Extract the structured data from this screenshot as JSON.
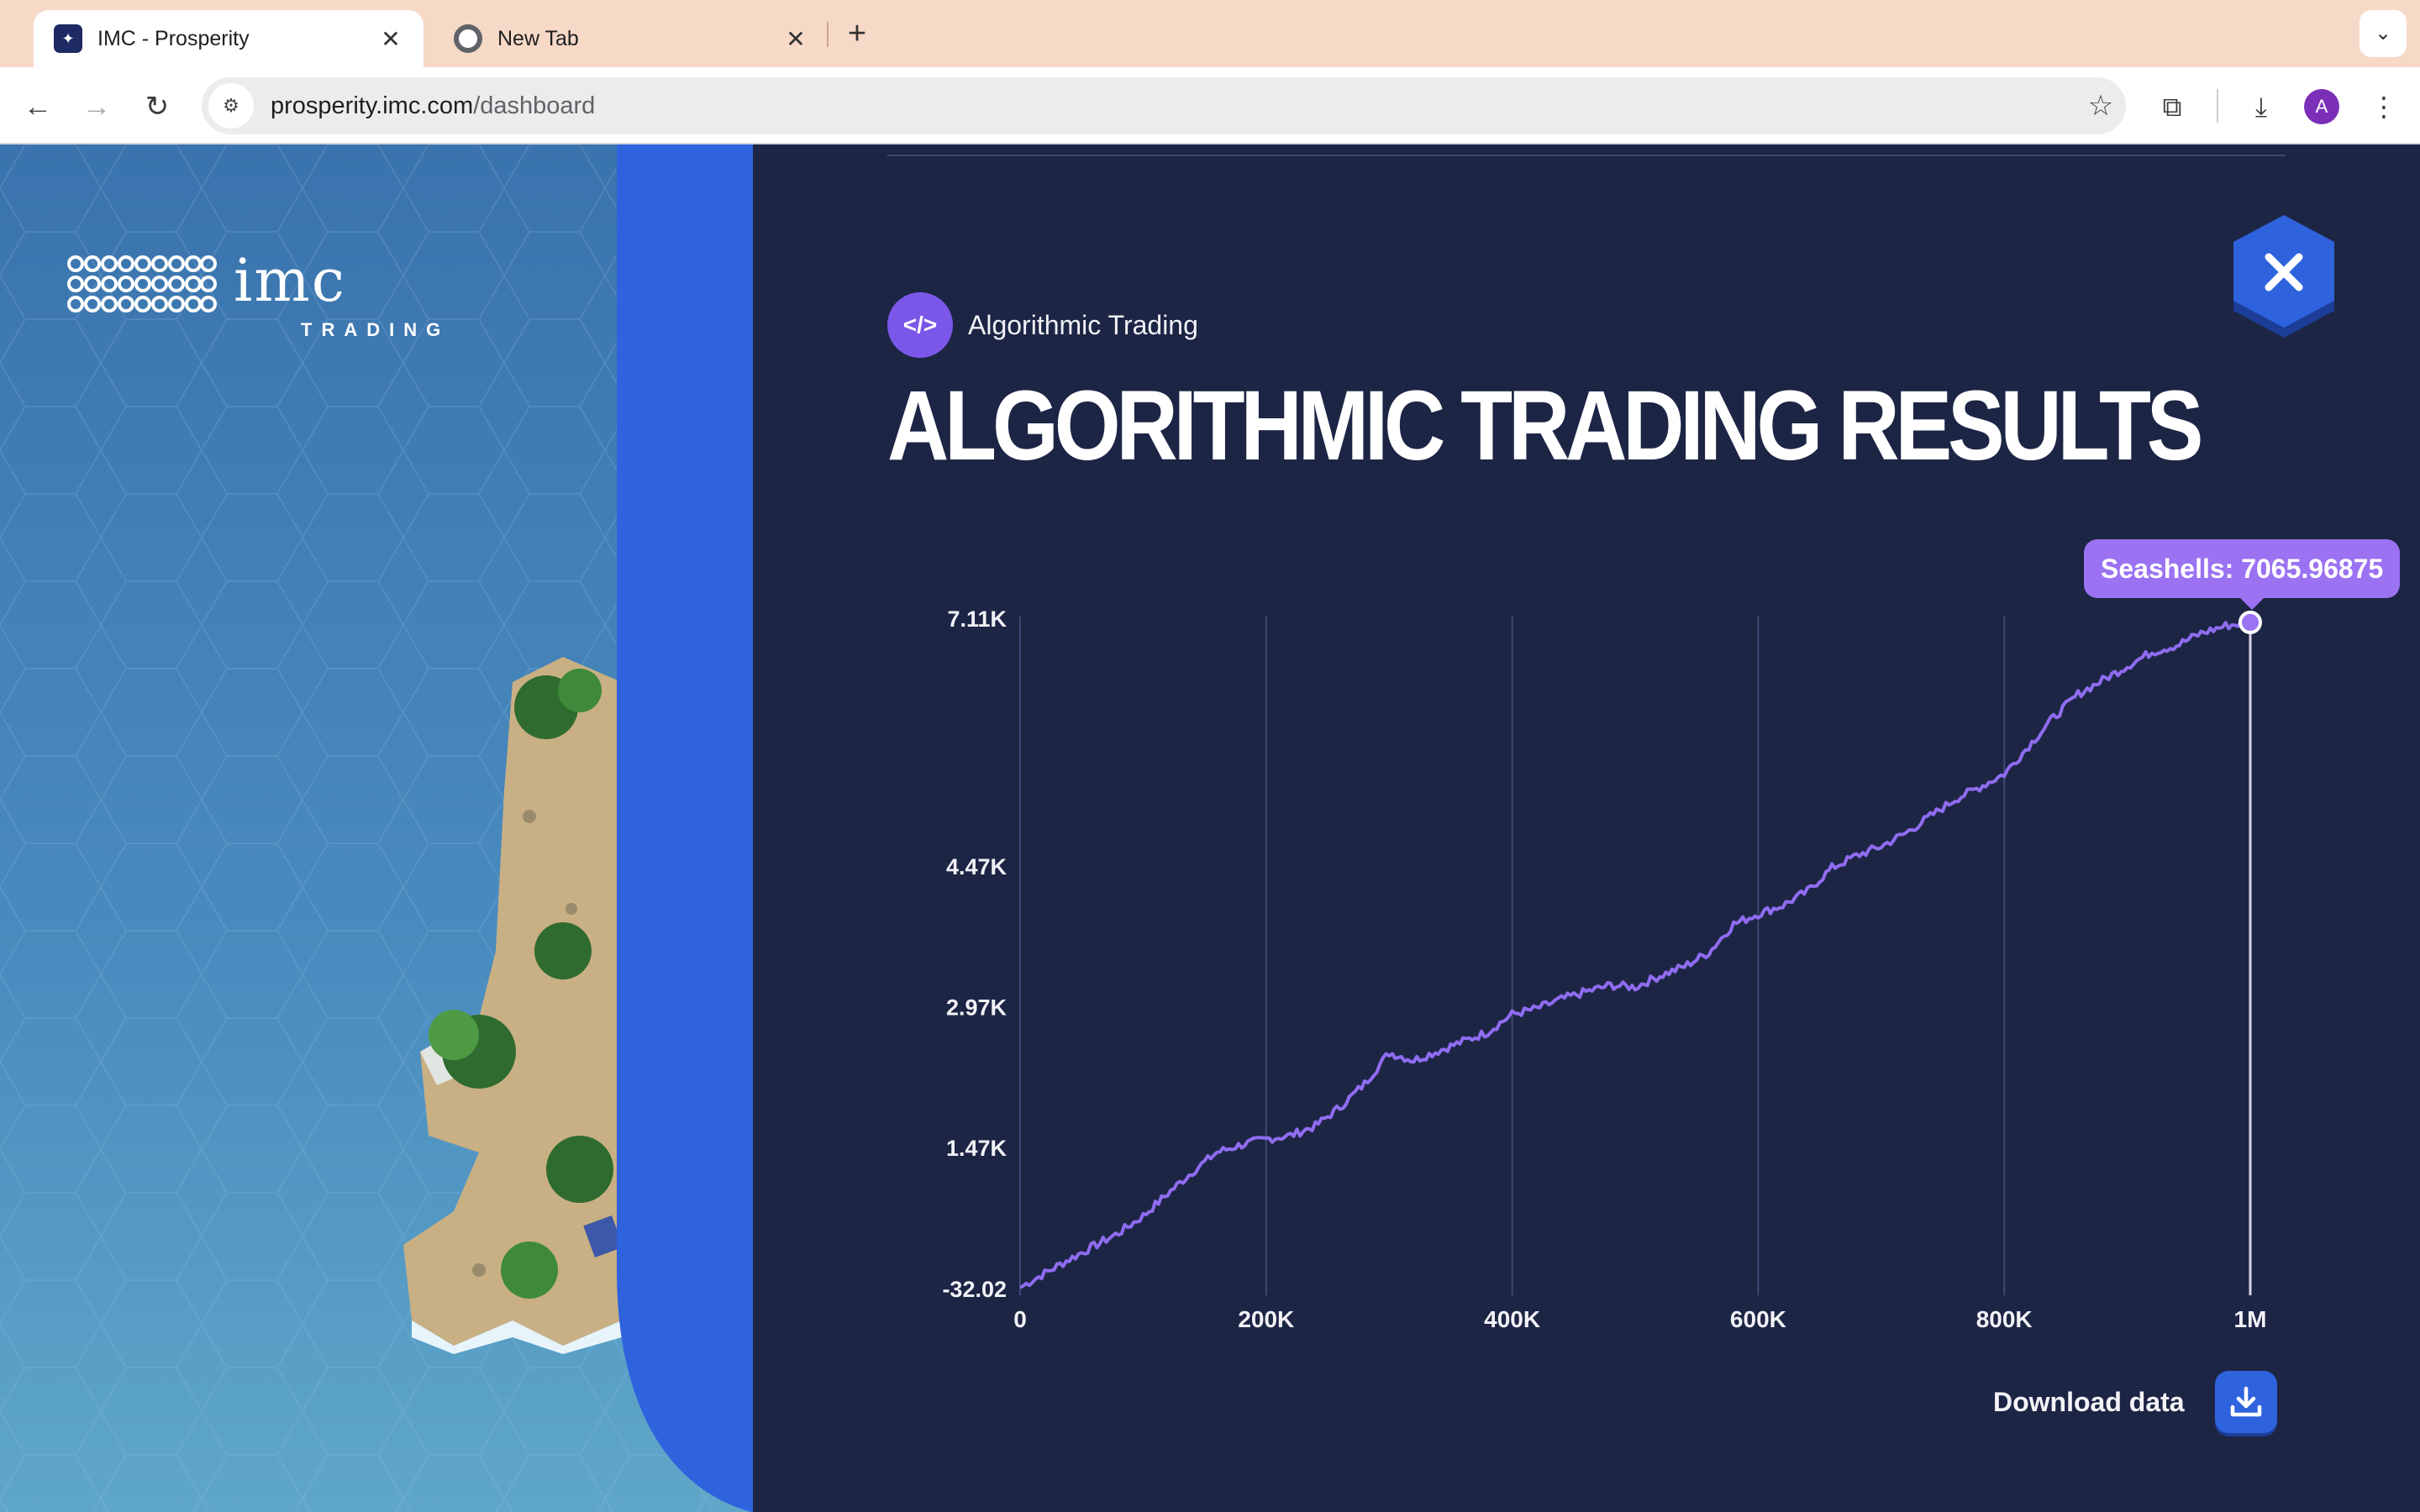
{
  "browser": {
    "tabs": [
      {
        "title": "IMC - Prosperity",
        "active": true
      },
      {
        "title": "New Tab",
        "active": false
      }
    ],
    "url_host": "prosperity.imc.com",
    "url_path": "/dashboard",
    "avatar_letter": "A"
  },
  "brand": {
    "logo_word": "imc",
    "logo_sub": "TRADING"
  },
  "header": {
    "category": "Algorithmic Trading",
    "title": "ALGORITHMIC TRADING RESULTS"
  },
  "tooltip": {
    "text": "Seashells: 7065.96875"
  },
  "actions": {
    "download_label": "Download data"
  },
  "colors": {
    "page_bg": "#1d2545",
    "accent_blue": "#2f63de",
    "line_purple": "#8f6cf0",
    "tooltip_bg": "#9a72f2"
  },
  "chart_data": {
    "type": "line",
    "title": "",
    "xlabel": "",
    "ylabel": "",
    "x_ticks": [
      "0",
      "200K",
      "400K",
      "600K",
      "800K",
      "1M"
    ],
    "y_ticks": [
      "-32.02",
      "1.47K",
      "2.97K",
      "4.47K",
      "7.11K"
    ],
    "y_tick_values": [
      -32.02,
      1470,
      2970,
      4470,
      7110
    ],
    "xlim": [
      0,
      1000000
    ],
    "ylim": [
      -32.02,
      7110
    ],
    "grid": "vertical",
    "series": [
      {
        "x": [
          0,
          20000,
          40000,
          60000,
          80000,
          100000,
          120000,
          140000,
          160000,
          180000,
          200000,
          220000,
          240000,
          260000,
          280000,
          300000,
          320000,
          340000,
          360000,
          380000,
          400000,
          420000,
          440000,
          460000,
          480000,
          500000,
          520000,
          540000,
          560000,
          580000,
          600000,
          620000,
          640000,
          660000,
          680000,
          700000,
          720000,
          740000,
          760000,
          780000,
          800000,
          820000,
          840000,
          860000,
          880000,
          900000,
          920000,
          940000,
          960000,
          980000,
          1000000
        ],
        "values": [
          -20,
          130,
          280,
          420,
          560,
          740,
          980,
          1210,
          1420,
          1500,
          1560,
          1600,
          1700,
          1900,
          2150,
          2480,
          2400,
          2500,
          2600,
          2700,
          2890,
          2950,
          3050,
          3130,
          3200,
          3180,
          3300,
          3400,
          3550,
          3850,
          3960,
          4050,
          4200,
          4450,
          4580,
          4680,
          4820,
          5000,
          5180,
          5310,
          5450,
          5750,
          6050,
          6300,
          6450,
          6600,
          6750,
          6820,
          6950,
          7030,
          7066
        ]
      }
    ],
    "highlight": {
      "x": 1000000,
      "y": 7065.96875
    }
  }
}
